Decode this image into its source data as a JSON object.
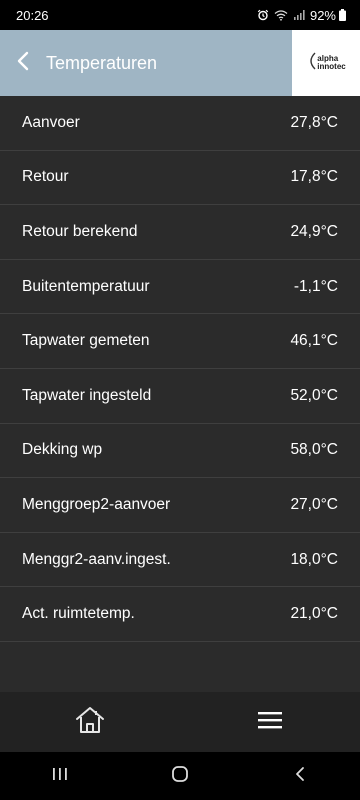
{
  "status_bar": {
    "time": "20:26",
    "battery_percent": "92%",
    "icons": [
      "alarm-icon",
      "wifi-icon",
      "signal-icon",
      "battery-icon"
    ]
  },
  "app_bar": {
    "title": "Temperaturen",
    "logo_text": "alpha\ninnotec"
  },
  "rows": [
    {
      "label": "Aanvoer",
      "value": "27,8°C"
    },
    {
      "label": "Retour",
      "value": "17,8°C"
    },
    {
      "label": "Retour berekend",
      "value": "24,9°C"
    },
    {
      "label": "Buitentemperatuur",
      "value": "-1,1°C"
    },
    {
      "label": "Tapwater gemeten",
      "value": "46,1°C"
    },
    {
      "label": "Tapwater ingesteld",
      "value": "52,0°C"
    },
    {
      "label": "Dekking wp",
      "value": "58,0°C"
    },
    {
      "label": "Menggroep2-aanvoer",
      "value": "27,0°C"
    },
    {
      "label": "Menggr2-aanv.ingest.",
      "value": "18,0°C"
    },
    {
      "label": "Act. ruimtetemp.",
      "value": "21,0°C"
    }
  ],
  "bottom_nav": {
    "items": [
      "home-icon",
      "menu-icon"
    ]
  },
  "system_nav": {
    "items": [
      "recent-apps-icon",
      "home-circle-icon",
      "back-chevron-icon"
    ]
  },
  "colors": {
    "app_bar": "#9fb5c4",
    "background": "#2b2b2b",
    "bottom_nav": "#222222",
    "divider": "#3f3f3f"
  }
}
